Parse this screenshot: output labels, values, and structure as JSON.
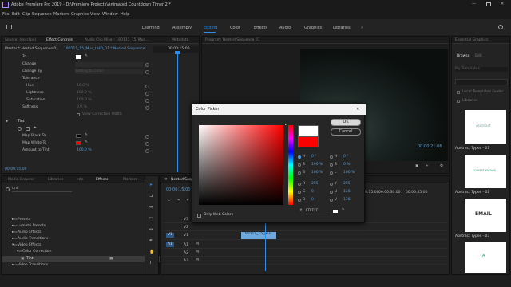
{
  "window": {
    "title": "Adobe Premiere Pro 2019 - D:\\Premiere Projects\\Animated Countdown Timer 2 *",
    "minimize_icon": "minimize-icon",
    "maximize_icon": "maximize-icon",
    "close_icon": "close-icon"
  },
  "menu": [
    "File",
    "Edit",
    "Clip",
    "Sequence",
    "Markers",
    "Graphics",
    "View",
    "Window",
    "Help"
  ],
  "workspaces": {
    "items": [
      "Learning",
      "Assembly",
      "Editing",
      "Color",
      "Effects",
      "Audio",
      "Graphics",
      "Libraries"
    ],
    "active": "Editing"
  },
  "source_panel": {
    "tabs": [
      "Source: (no clips)",
      "Effect Controls",
      "Audio Clip Mixer: 190111_15_Mus...",
      "Metadata"
    ],
    "header_left": "Master * Nested Sequence 01",
    "header_right": "190111_15_Mus_UHD_01 * Nested Sequence",
    "timecode": "00:00:15:00",
    "rows": [
      {
        "label": "To",
        "value": ""
      },
      {
        "label": "Change",
        "value": ""
      },
      {
        "label": "Change By",
        "value": "Setting to Color"
      },
      {
        "label": "Tolerance",
        "value": ""
      },
      {
        "label": "Hue",
        "value": "10.0 %"
      },
      {
        "label": "Lightness",
        "value": "100.0 %"
      },
      {
        "label": "Saturation",
        "value": "100.0 %"
      },
      {
        "label": "Softness",
        "value": "0.0 %"
      },
      {
        "label": "",
        "value": "View Correction Matte"
      },
      {
        "label": "Tint",
        "value": ""
      },
      {
        "label": "",
        "value": ""
      },
      {
        "label": "Map Black To",
        "value": ""
      },
      {
        "label": "Map White To",
        "value": ""
      },
      {
        "label": "Amount to Tint",
        "value": "100.0 %"
      }
    ],
    "footer_time": "00:00:15:00"
  },
  "program": {
    "title": "Program: Nested Sequence 01",
    "timecode": "00:00:21:06"
  },
  "essential": {
    "title": "Essential Graphics",
    "tabs": [
      "Browse",
      "Edit"
    ],
    "search_placeholder": "My Templates",
    "options": [
      "Local Templates Folder",
      "Libraries"
    ],
    "templates": [
      "Abstract Types - 01",
      "Abstract Types - 02",
      "Abstract Types - 03"
    ],
    "thumb_texts": [
      "Abstract",
      "FORMAT SHOWS",
      "EMAIL"
    ]
  },
  "project": {
    "tabs": [
      "Media Browser",
      "Libraries",
      "Info",
      "Effects",
      "Markers"
    ],
    "search_placeholder": "tint",
    "tree": [
      {
        "label": "Presets",
        "indent": 0
      },
      {
        "label": "Lumetri Presets",
        "indent": 0
      },
      {
        "label": "Audio Effects",
        "indent": 0
      },
      {
        "label": "Audio Transitions",
        "indent": 0
      },
      {
        "label": "Video Effects",
        "indent": 0
      },
      {
        "label": "Color Correction",
        "indent": 1
      },
      {
        "label": "Tint",
        "indent": 2
      },
      {
        "label": "Video Transitions",
        "indent": 0
      }
    ]
  },
  "timeline": {
    "tab": "Nested Sequence 01",
    "timecode": "00:00:15:00",
    "ruler": [
      "00:00",
      "00:00:15:00",
      "00:00:30:00",
      "00:00:45:00"
    ],
    "tracks": [
      "V3",
      "V2",
      "V1",
      "A1",
      "A2",
      "A3"
    ],
    "clip": "190111_15_Mus..."
  },
  "color_picker": {
    "title": "Color Picker",
    "ok": "OK",
    "cancel": "Cancel",
    "only_web": "Only Web Colors",
    "fields": [
      {
        "label": "H",
        "value": "0 °"
      },
      {
        "label": "S",
        "value": "100 %"
      },
      {
        "label": "B",
        "value": "100 %"
      },
      {
        "label": "R",
        "value": "255"
      },
      {
        "label": "G",
        "value": "0"
      },
      {
        "label": "B",
        "value": "0"
      }
    ],
    "fields2": [
      {
        "label": "H",
        "value": "0 °"
      },
      {
        "label": "S",
        "value": "0 %"
      },
      {
        "label": "L",
        "value": "100 %"
      },
      {
        "label": "Y",
        "value": "255"
      },
      {
        "label": "U",
        "value": "128"
      },
      {
        "label": "V",
        "value": "128"
      }
    ],
    "hex_label": "#",
    "hex": "FFFFFF",
    "colors": {
      "new": "#ffffff",
      "current": "#ff0000",
      "hue": "#ff0000"
    }
  },
  "colors": {
    "accent": "#2d8ceb",
    "timecode": "#5b9bd5",
    "clip": "#6fa8dc"
  }
}
